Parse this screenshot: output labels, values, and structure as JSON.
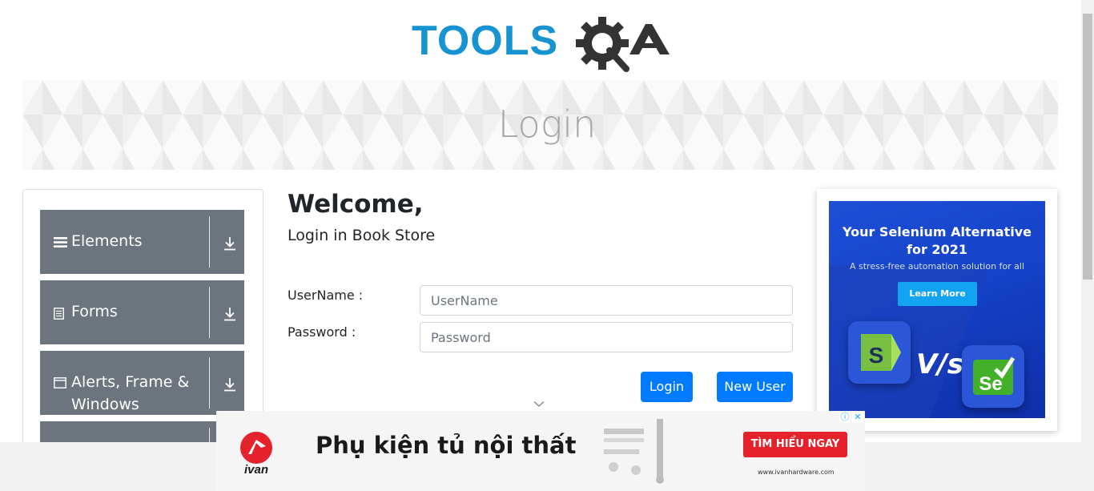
{
  "header": {
    "logo_text": "TOOLSQA",
    "logo_colors": {
      "tools": "#1793d1",
      "qa": "#333333"
    }
  },
  "banner": {
    "title": "Login"
  },
  "sidebar": {
    "items": [
      {
        "label": "Elements",
        "icon": "hamburger-icon"
      },
      {
        "label": "Forms",
        "icon": "document-icon"
      },
      {
        "label": "Alerts, Frame & Windows",
        "icon": "window-icon"
      },
      {
        "label": "",
        "icon": ""
      }
    ]
  },
  "form": {
    "welcome": "Welcome,",
    "subtitle": "Login in Book Store",
    "username_label": "UserName :",
    "username_placeholder": "UserName",
    "password_label": "Password :",
    "password_placeholder": "Password",
    "login_button": "Login",
    "new_user_button": "New User"
  },
  "side_ad": {
    "headline_1": "Your Selenium Alternative",
    "headline_2": "for 2021",
    "tagline": "A stress-free automation solution for all",
    "cta": "Learn More",
    "vs": "V/s",
    "logo_right": "Se"
  },
  "bottom_ad": {
    "brand": "ivan",
    "headline": "Phụ kiện tủ nội thất",
    "cta": "TÌM HIỂU NGAY",
    "url": "www.ivanhardware.com"
  },
  "colors": {
    "menu_bg": "#6c757d",
    "primary": "#007bff",
    "banner_title": "#a6a6a6",
    "ad_cta_red": "#e5212b"
  }
}
